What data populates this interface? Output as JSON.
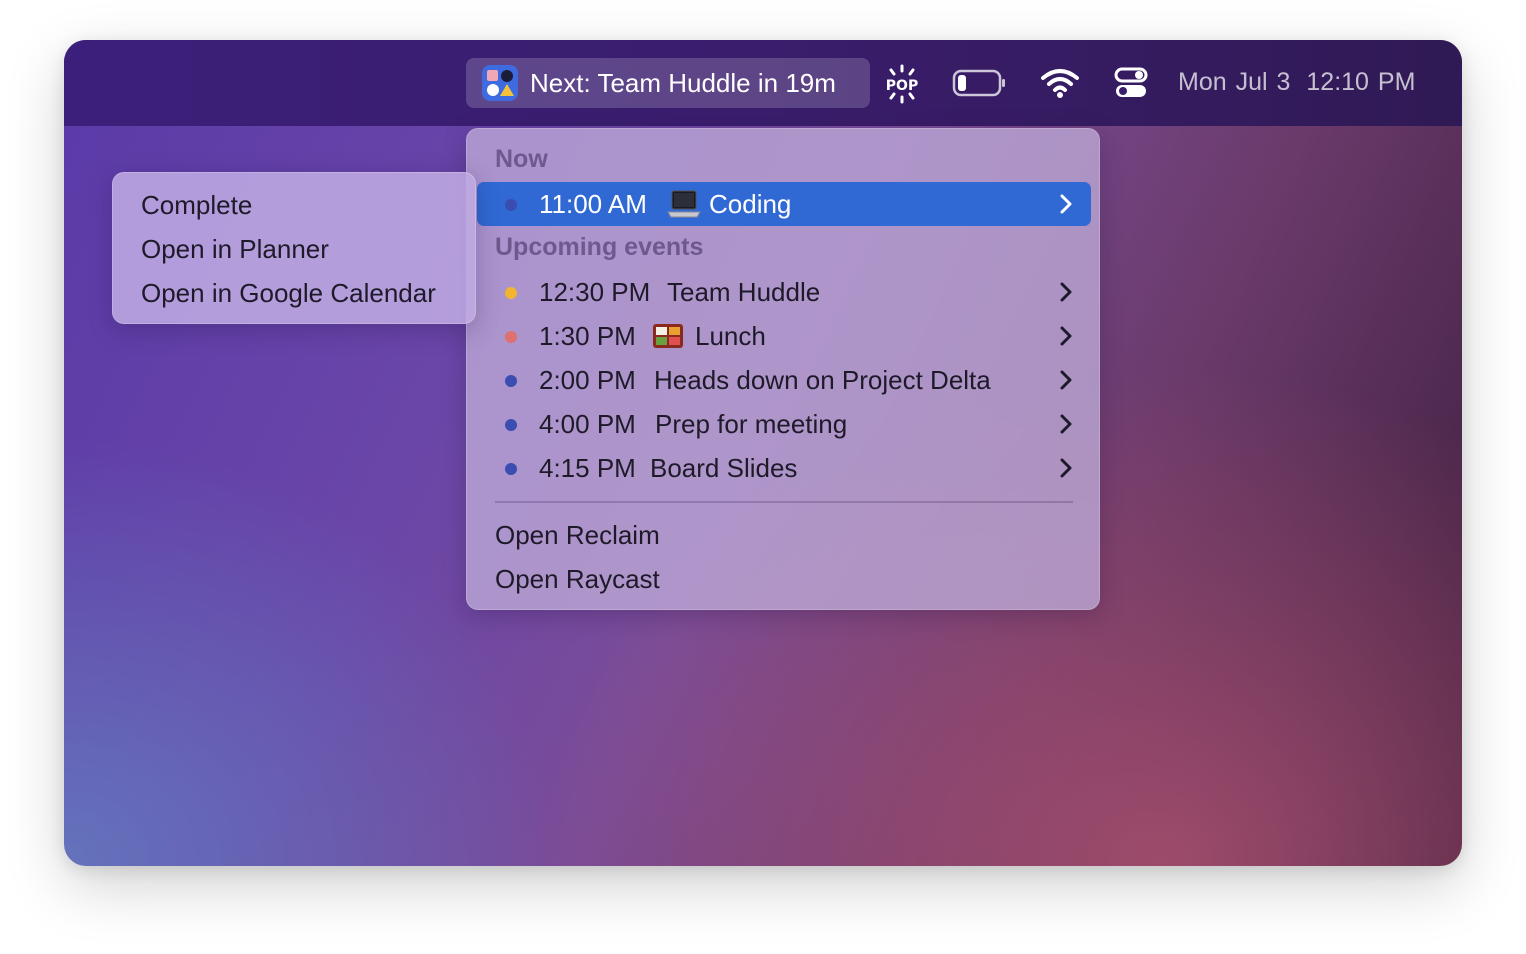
{
  "menubar": {
    "reclaim_label": "Next: Team Huddle in 19m",
    "icons": [
      "reclaim-app-icon",
      "pop-icon",
      "battery-icon",
      "wifi-icon",
      "control-center-icon"
    ],
    "date": "Mon Jul 3",
    "time": "12:10 PM"
  },
  "menu": {
    "now_header": "Now",
    "now_event": {
      "time": "11:00 AM",
      "emoji": "laptop-icon",
      "title": "Coding",
      "color": "#3b4db0"
    },
    "upcoming_header": "Upcoming events",
    "upcoming": [
      {
        "time": "12:30 PM",
        "title": "Team Huddle",
        "color": "#f2b530"
      },
      {
        "time": "1:30 PM",
        "emoji": "bento-box-icon",
        "title": "Lunch",
        "color": "#e07070"
      },
      {
        "time": "2:00 PM",
        "title": "Heads down on Project Delta",
        "color": "#3b4db0"
      },
      {
        "time": "4:00 PM",
        "title": "Prep for meeting",
        "color": "#3b4db0"
      },
      {
        "time": "4:15 PM",
        "title": "Board Slides",
        "color": "#3b4db0"
      }
    ],
    "actions": [
      "Open Reclaim",
      "Open Raycast"
    ]
  },
  "submenu": {
    "items": [
      "Complete",
      "Open in Planner",
      "Open in Google Calendar"
    ]
  },
  "colors": {
    "selection": "#3069d4",
    "menubar": "#3a1d6c"
  }
}
